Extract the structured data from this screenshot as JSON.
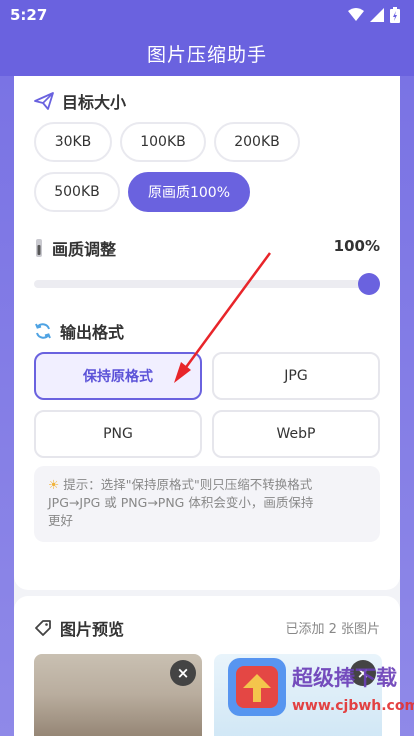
{
  "status": {
    "time": "5:27"
  },
  "app": {
    "title": "图片压缩助手"
  },
  "target_size": {
    "title": "目标大小",
    "options": [
      "30KB",
      "100KB",
      "200KB",
      "500KB",
      "原画质100%"
    ],
    "selected": "原画质100%"
  },
  "quality": {
    "label": "画质调整",
    "value_text": "100%",
    "value": 1.0
  },
  "output_format": {
    "title": "输出格式",
    "options": [
      "保持原格式",
      "JPG",
      "PNG",
      "WebP"
    ],
    "selected": "保持原格式"
  },
  "tip": {
    "line1": "提示：选择\"保持原格式\"则只压缩不转换格式",
    "line2": "JPG→JPG 或 PNG→PNG 体积会变小，画质保持",
    "line3": "更好"
  },
  "preview": {
    "title": "图片预览",
    "count_text": "已添加 2 张图片",
    "remove_label": "×"
  },
  "watermark": {
    "brand": "超级捧下载",
    "url": "www.cjbwh.com"
  },
  "colors": {
    "accent": "#6a62df",
    "arrow": "#e8252a"
  }
}
